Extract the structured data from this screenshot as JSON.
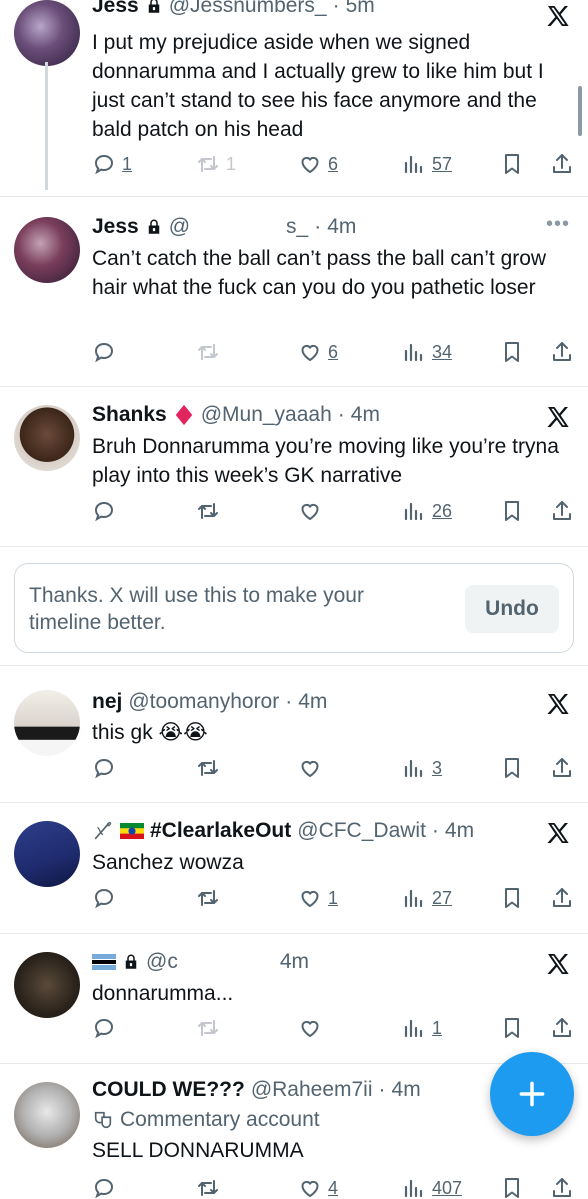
{
  "tweets": [
    {
      "name": "Jess",
      "handle": "@Jessnumbers_",
      "time": "5m",
      "text": "I put my prejudice aside when we signed donnarumma and I actually grew to like him but I just can’t stand to see his face anymore and the bald patch on his head",
      "replies": "1",
      "reposts": "1",
      "likes": "6",
      "views": "57"
    },
    {
      "name": "Jess",
      "handle": "@",
      "handle_tail": "s_",
      "time": "4m",
      "text": "Can’t catch the ball can’t pass the ball can’t grow hair what the fuck can you do you pathetic loser",
      "likes": "6",
      "views": "34"
    },
    {
      "name": "Shanks",
      "handle": "@Mun_yaaah",
      "time": "4m",
      "text": "Bruh Donnarumma you’re moving like you’re tryna play into this week’s GK narrative",
      "views": "26"
    },
    {
      "name": "nej",
      "handle": "@toomanyhoror",
      "time": "4m",
      "text": "this gk 😭😭",
      "views": "3"
    },
    {
      "name": "#ClearlakeOut",
      "handle": "@CFC_Dawit",
      "time": "4m",
      "text": "Sanchez wowza",
      "likes": "1",
      "views": "27"
    },
    {
      "name": "",
      "handle": "@c",
      "time": "4m",
      "text": "donnarumma...",
      "views": "1"
    },
    {
      "name": "COULD WE???",
      "handle": "@Raheem7ii",
      "time": "4m",
      "label": "Commentary account",
      "text": "SELL DONNARUMMA",
      "likes": "4",
      "views": "407"
    }
  ],
  "feedback": {
    "message": "Thanks. X will use this to make your timeline better.",
    "undo_label": "Undo"
  },
  "colors": {
    "accent": "#1d9bf0",
    "verified_diamond": "#e0245e",
    "muted": "#536471"
  }
}
